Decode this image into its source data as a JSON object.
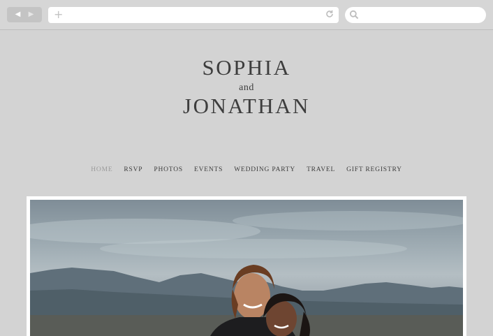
{
  "browser": {
    "back_icon": "◀",
    "forward_icon": "▶",
    "new_tab_icon": "+",
    "url": "",
    "search_placeholder": ""
  },
  "header": {
    "name_1": "SOPHIA",
    "conjunction": "and",
    "name_2": "JONATHAN"
  },
  "nav": {
    "items": [
      {
        "label": "HOME",
        "active": true
      },
      {
        "label": "RSVP",
        "active": false
      },
      {
        "label": "PHOTOS",
        "active": false
      },
      {
        "label": "EVENTS",
        "active": false
      },
      {
        "label": "WEDDING PARTY",
        "active": false
      },
      {
        "label": "TRAVEL",
        "active": false
      },
      {
        "label": "GIFT REGISTRY",
        "active": false
      }
    ]
  },
  "hero": {
    "image": "couple-photo"
  },
  "colors": {
    "background": "#d3d3d3",
    "text": "#3d3d3d",
    "nav_active": "#9a9a9a"
  }
}
